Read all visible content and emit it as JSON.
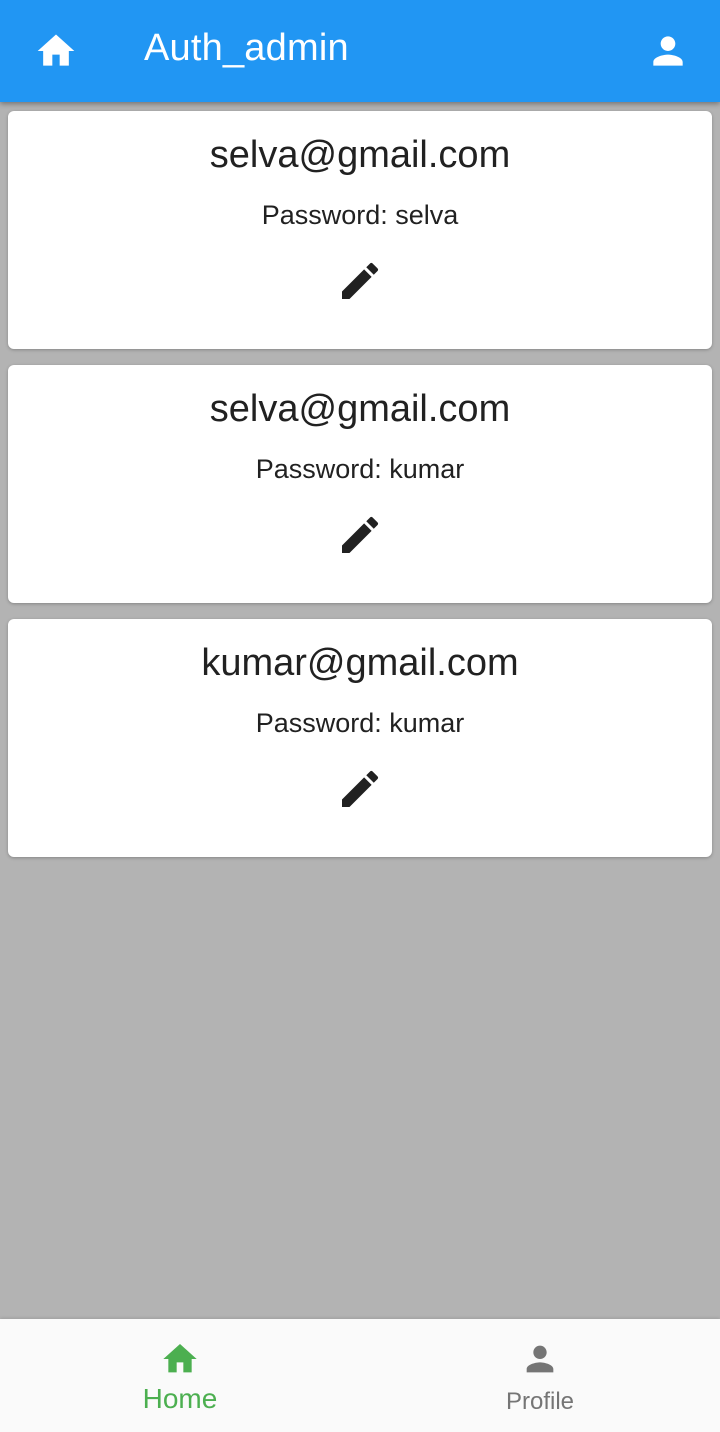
{
  "app_bar": {
    "title": "Auth_admin",
    "background_color": "#2196f3",
    "leading_icon": "home-icon",
    "trailing_icon": "person-icon"
  },
  "users": [
    {
      "email": "selva@gmail.com",
      "password_text": "Password: selva",
      "action_icon": "edit-icon"
    },
    {
      "email": "selva@gmail.com",
      "password_text": "Password: kumar",
      "action_icon": "edit-icon"
    },
    {
      "email": "kumar@gmail.com",
      "password_text": "Password: kumar",
      "action_icon": "edit-icon"
    }
  ],
  "bottom_nav": {
    "active_color": "#4caf50",
    "inactive_color": "#757575",
    "items": [
      {
        "label": "Home",
        "icon": "home-icon",
        "active": true
      },
      {
        "label": "Profile",
        "icon": "person-icon",
        "active": false
      }
    ]
  }
}
